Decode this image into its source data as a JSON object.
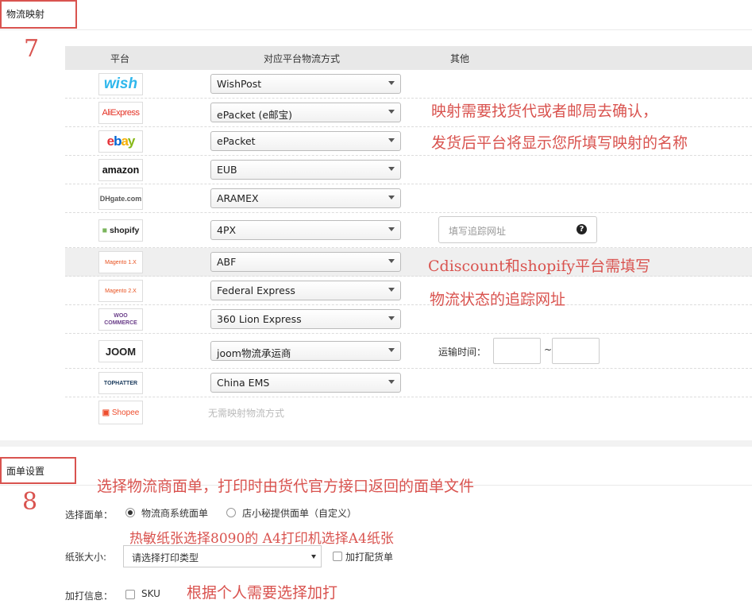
{
  "section1": {
    "title": "物流映射",
    "step": "7"
  },
  "table": {
    "headers": {
      "platform": "平台",
      "method": "对应平台物流方式",
      "other": "其他"
    },
    "rows": [
      {
        "platform": "wish",
        "method": "WishPost"
      },
      {
        "platform": "AliExpress",
        "method": "ePacket (e邮宝)"
      },
      {
        "platform": "ebay",
        "method": "ePacket"
      },
      {
        "platform": "amazon",
        "method": "EUB"
      },
      {
        "platform": "DHgate.com",
        "method": "ARAMEX"
      },
      {
        "platform": "shopify",
        "method": "4PX"
      },
      {
        "platform": "Magento 1.X",
        "method": "ABF"
      },
      {
        "platform": "Magento 2.X",
        "method": "Federal Express"
      },
      {
        "platform": "WOO COMMERCE",
        "method": "360 Lion Express"
      },
      {
        "platform": "JOOM",
        "method": "joom物流承运商"
      },
      {
        "platform": "TOPHATTER",
        "method": "China EMS"
      },
      {
        "platform": "Shopee",
        "method": ""
      }
    ],
    "tracking_placeholder": "填写追踪网址",
    "shipping_time_label": "运输时间：",
    "shipping_sep": "~",
    "no_mapping_text": "无需映射物流方式"
  },
  "notes": {
    "mapping_1": "映射需要找货代或者邮局去确认，",
    "mapping_2": "发货后平台将显示您所填写映射的名称",
    "tracking_1": "Cdiscount和shopify平台需填写",
    "tracking_2": "物流状态的追踪网址",
    "face_sheet": "选择物流商面单，打印时由货代官方接口返回的面单文件",
    "paper": "热敏纸张选择8090的 A4打印机选择A4纸张",
    "extra": "根据个人需要选择加打"
  },
  "section2": {
    "title": "面单设置",
    "step": "8",
    "select_label": "选择面单：",
    "option_carrier": "物流商系统面单",
    "option_shop": "店小秘提供面单（自定义）",
    "paper_label": "纸张大小:",
    "paper_placeholder": "请选择打印类型",
    "print_packing": "加打配货单",
    "extra_label": "加打信息：",
    "sku": "SKU"
  },
  "colors": {
    "accent": "#d9534f",
    "header_bg": "#e8e8e8"
  }
}
